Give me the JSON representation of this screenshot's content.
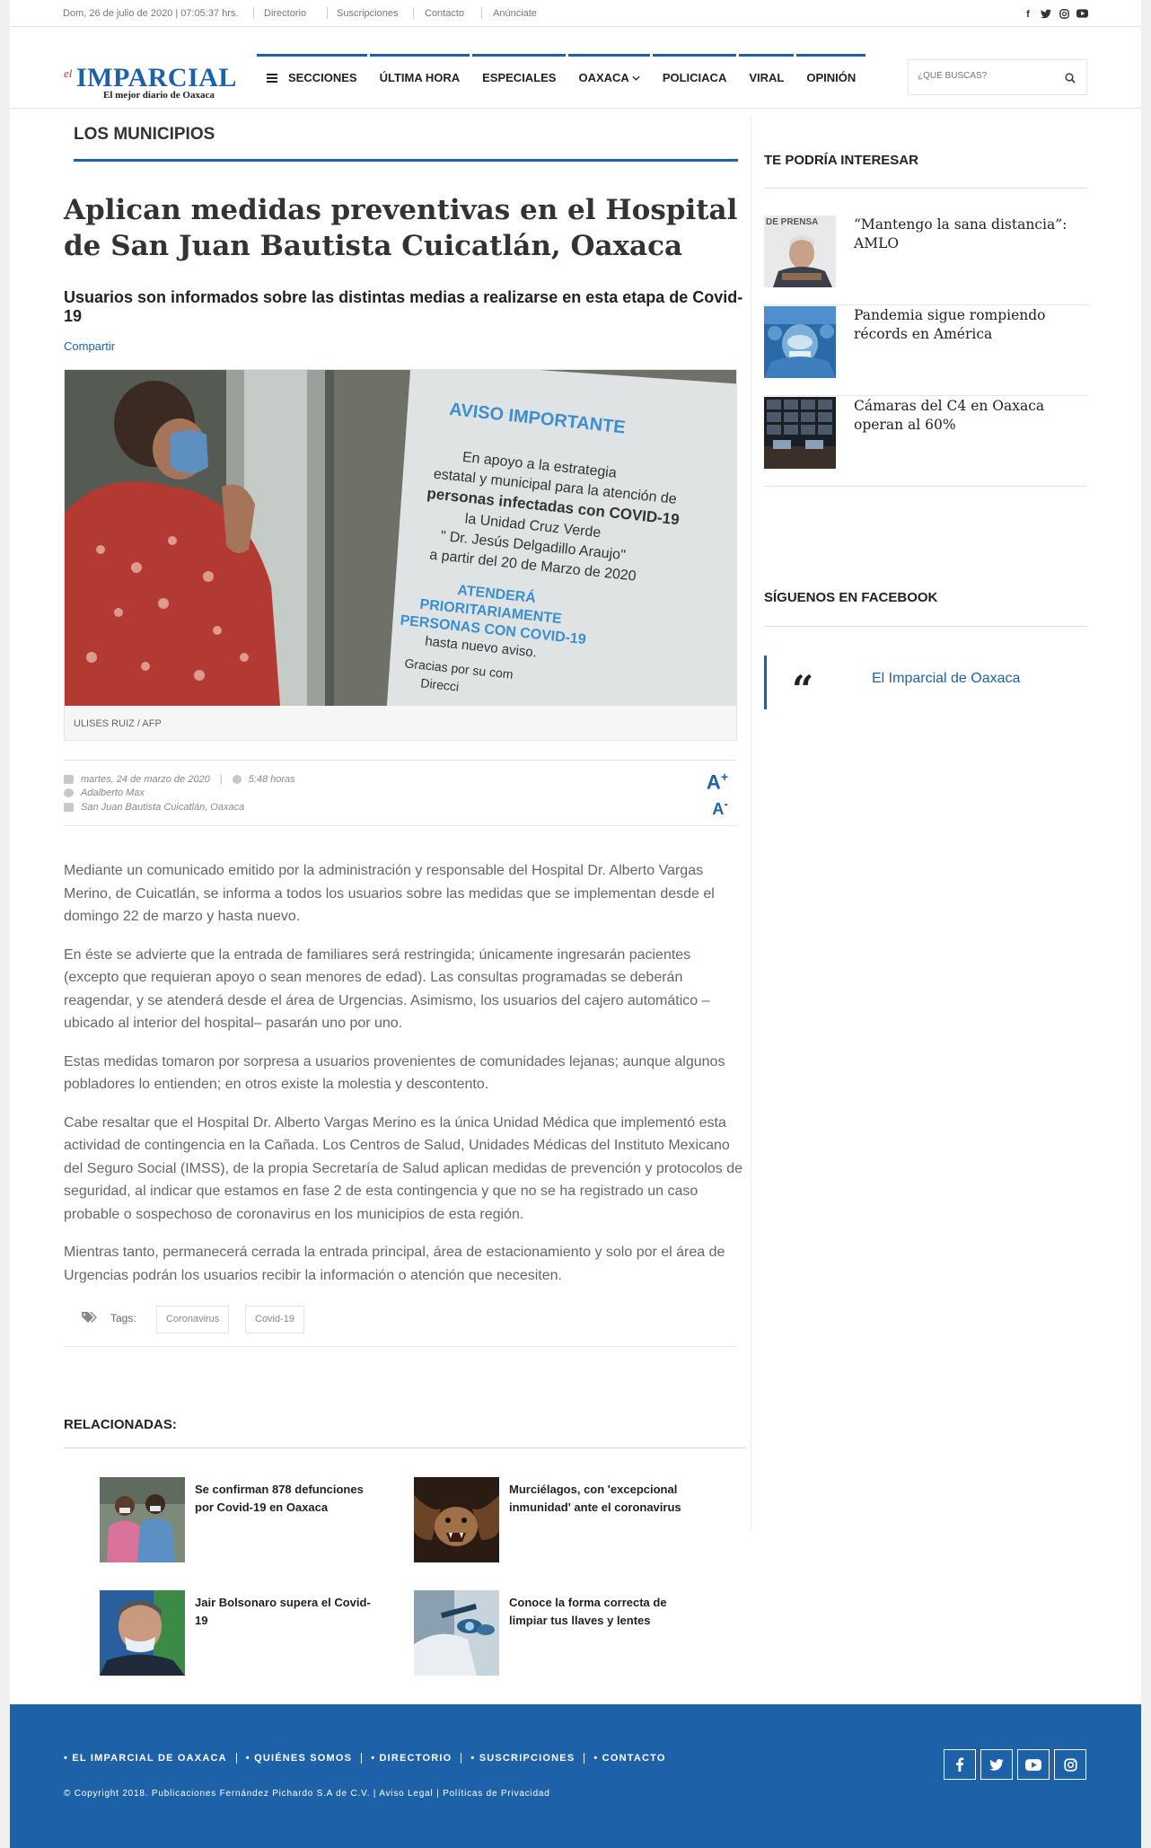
{
  "topbar": {
    "date": "Dom, 26 de julio de 2020 | 07:05:37 hrs.",
    "links": [
      "Directorio",
      "Suscripciones",
      "Contacto",
      "Anúnciate"
    ]
  },
  "logo": {
    "el": "el",
    "main": "IMPARCIAL",
    "sub": "El mejor diario de Oaxaca"
  },
  "nav": {
    "secciones": "SECCIONES",
    "items": [
      "ÚLTIMA HORA",
      "ESPECIALES",
      "OAXACA",
      "POLICIACA",
      "VIRAL",
      "OPINIÓN"
    ]
  },
  "search": {
    "placeholder": "¿QUÉ BUSCAS?"
  },
  "article": {
    "section": "LOS MUNICIPIOS",
    "headline": "Aplican medidas preventivas en el Hospital de San Juan Bautista Cuicatlán, Oaxaca",
    "deck": "Usuarios son informados sobre las distintas medias a realizarse en esta etapa de Covid-19",
    "share": "Compartir",
    "photo_sign": {
      "title": "AVISO IMPORTANTE",
      "l1": "En apoyo a la estrategia",
      "l2": "estatal y municipal para la atención de",
      "l3": "personas infectadas con COVID-19",
      "l4": "la Unidad Cruz Verde",
      "l5": "\" Dr. Jesús Delgadillo Araujo\"",
      "l6": "a partir del 20 de Marzo de 2020",
      "l7": "ATENDERÁ",
      "l8": "PRIORITARIAMENTE",
      "l9": "PERSONAS CON COVID-19",
      "l10": "hasta nuevo aviso.",
      "l11": "Gracias por su com",
      "l12": "Direcci"
    },
    "caption": "ULISES RUIZ / AFP",
    "date": "martes, 24 de marzo de 2020",
    "time": "5:48 horas",
    "author": "Adalberto Max",
    "location": "San Juan Bautista Cuicatlán, Oaxaca",
    "font_up": "A",
    "font_down": "A",
    "paragraphs": [
      "Mediante un comunicado emitido por la administración y responsable del Hospital Dr. Alberto Vargas Merino, de Cuicatlán, se informa a todos los usuarios sobre las medidas que se implementan desde el domingo 22 de marzo y hasta nuevo.",
      "En éste se advierte que la entrada de familiares será restringida; únicamente ingresarán pacientes (excepto que requieran apoyo o sean menores de edad). Las consultas programadas se deberán reagendar, y se atenderá desde el área de Urgencias. Asimismo, los usuarios del cajero automático –ubicado al interior del hospital– pasarán uno por uno.",
      "Estas medidas tomaron por sorpresa a usuarios provenientes de comunidades lejanas; aunque algunos pobladores lo entienden; en otros existe la molestia y descontento.",
      "Cabe resaltar que el Hospital Dr. Alberto Vargas Merino es la única Unidad Médica que implementó esta actividad de contingencia en la Cañada. Los Centros de Salud, Unidades Médicas del Instituto Mexicano del Seguro Social (IMSS), de la propia Secretaría de Salud aplican medidas de prevención y protocolos de seguridad, al indicar que estamos en fase 2 de esta contingencia y que no se ha registrado un caso probable o sospechoso de coronavirus en los municipios de esta región.",
      "Mientras tanto, permanecerá cerrada la entrada principal, área de estacionamiento y solo por el área de Urgencias podrán los usuarios recibir la información o atención que necesiten."
    ],
    "tags_label": "Tags:",
    "tags": [
      "Coronavirus",
      "Covid-19"
    ]
  },
  "related": {
    "title": "RELACIONADAS:",
    "items": [
      "Se confirman 878 defunciones por Covid-19 en Oaxaca",
      "Murciélagos, con 'excepcional inmunidad' ante el coronavirus",
      "Jair Bolsonaro supera el Covid-19",
      "Conoce la forma correcta de limpiar tus llaves y lentes"
    ]
  },
  "sidebar": {
    "title": "TE PODRÍA INTERESAR",
    "items": [
      "“Mantengo la sana distancia”: AMLO",
      "Pandemia sigue rompiendo récords en América",
      "Cámaras del C4 en Oaxaca operan al 60%"
    ],
    "thumb_text": "DE PRENSA",
    "fb_title": "SÍGUENOS EN FACEBOOK",
    "fb_quote": "“",
    "fb_link": "El Imparcial de Oaxaca"
  },
  "footer": {
    "links": [
      "• EL IMPARCIAL DE OAXACA",
      "• QUIÉNES SOMOS",
      "• DIRECTORIO",
      "• SUSCRIPCIONES",
      "• CONTACTO"
    ],
    "copyright": "© Copyright 2018. Publicaciones Fernández Pichardo S.A de C.V. | Aviso Legal | Políticas de Privacidad"
  },
  "icons": [
    "facebook-icon",
    "twitter-icon",
    "instagram-icon",
    "youtube-icon",
    "search-icon",
    "calendar-icon",
    "clock-icon",
    "user-icon",
    "map-icon",
    "tags-icon"
  ],
  "colors": {
    "brand_blue": "#1d62a9",
    "text": "#333333",
    "muted": "#666666"
  }
}
